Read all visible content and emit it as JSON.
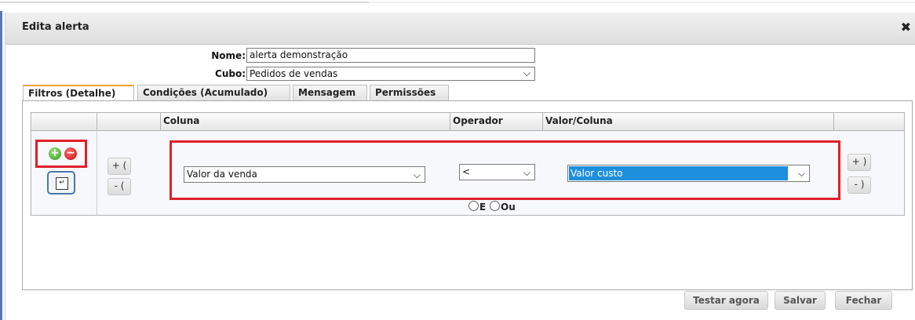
{
  "dialog": {
    "title": "Edita alerta",
    "close_icon": "✖"
  },
  "form": {
    "nome_label": "Nome:",
    "nome_value": "alerta demonstração",
    "cubo_label": "Cubo:",
    "cubo_value": "Pedidos de vendas"
  },
  "tabs": [
    {
      "label": "Filtros (Detalhe)",
      "active": true
    },
    {
      "label": "Condições (Acumulado)",
      "active": false
    },
    {
      "label": "Mensagem",
      "active": false
    },
    {
      "label": "Permissões",
      "active": false
    }
  ],
  "grid": {
    "headers": {
      "coluna": "Coluna",
      "operador": "Operador",
      "valor": "Valor/Coluna"
    },
    "row": {
      "open_paren_add": "+ (",
      "open_paren_remove": "- (",
      "coluna_value": "Valor da venda",
      "operador_value": "<",
      "valor_value": "Valor custo",
      "close_paren_add": "+ )",
      "close_paren_remove": "- )"
    },
    "logic": {
      "and_label": "E",
      "or_label": "Ou"
    }
  },
  "footer": {
    "test_label": "Testar agora",
    "save_label": "Salvar",
    "close_label": "Fechar"
  },
  "colors": {
    "highlight_red": "#e0202a",
    "selected_blue": "#1e8fdc",
    "tab_accent": "#f0a030"
  }
}
